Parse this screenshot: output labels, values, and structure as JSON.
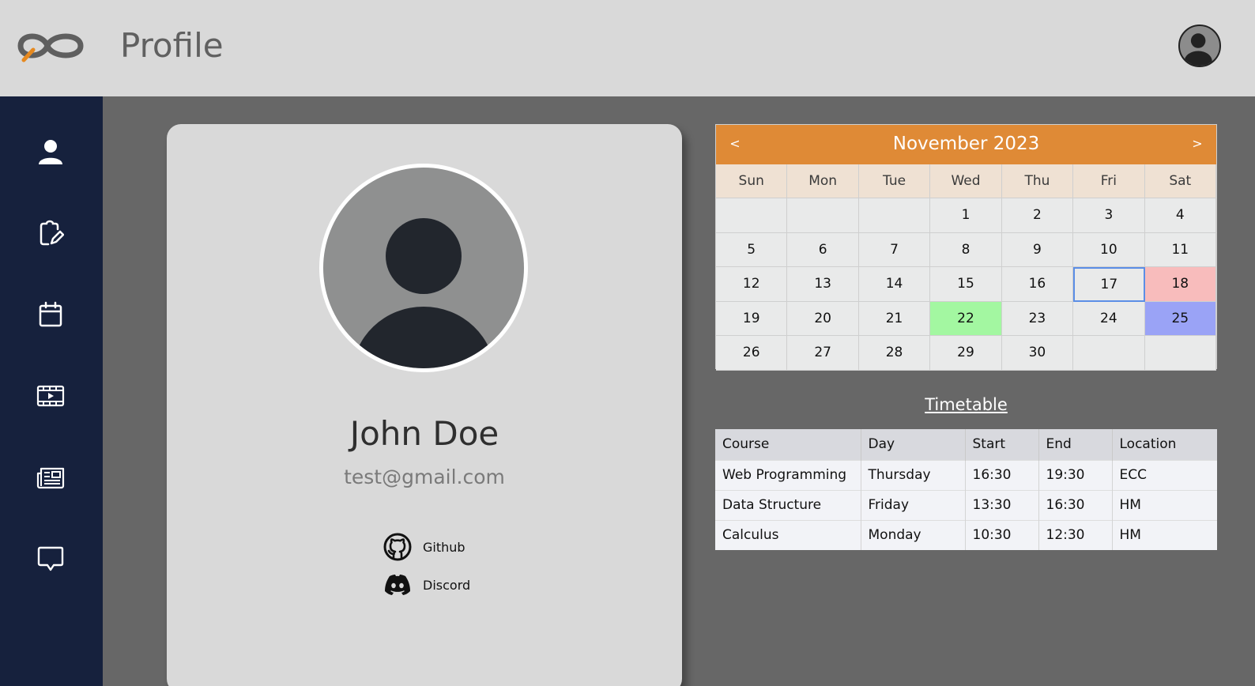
{
  "header": {
    "title": "Profile"
  },
  "sidebar": {
    "items": [
      {
        "icon": "user-icon"
      },
      {
        "icon": "edit-document-icon"
      },
      {
        "icon": "calendar-icon"
      },
      {
        "icon": "video-icon"
      },
      {
        "icon": "newspaper-icon"
      },
      {
        "icon": "chat-icon"
      }
    ]
  },
  "profile": {
    "name": "John Doe",
    "email": "test@gmail.com",
    "links": [
      {
        "label": "Github",
        "icon": "github-icon"
      },
      {
        "label": "Discord",
        "icon": "discord-icon"
      }
    ]
  },
  "calendar": {
    "title": "November 2023",
    "prev": "<",
    "next": ">",
    "weekdays": [
      "Sun",
      "Mon",
      "Tue",
      "Wed",
      "Thu",
      "Fri",
      "Sat"
    ],
    "leading_blank_days": 3,
    "days_in_month": 30,
    "selected_day": 17,
    "highlighted": [
      {
        "day": 18,
        "color": "#f8bcbc"
      },
      {
        "day": 22,
        "color": "#a3f7a1"
      },
      {
        "day": 25,
        "color": "#9aa3f6"
      }
    ],
    "header_color": "#df8a36"
  },
  "timetable": {
    "title": "Timetable",
    "columns": [
      "Course",
      "Day",
      "Start",
      "End",
      "Location"
    ],
    "rows": [
      [
        "Web Programming",
        "Thursday",
        "16:30",
        "19:30",
        "ECC"
      ],
      [
        "Data Structure",
        "Friday",
        "13:30",
        "16:30",
        "HM"
      ],
      [
        "Calculus",
        "Monday",
        "10:30",
        "12:30",
        "HM"
      ]
    ]
  }
}
